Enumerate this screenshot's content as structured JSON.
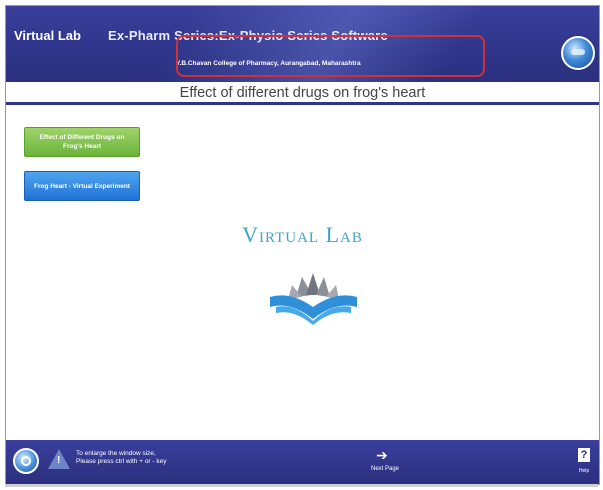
{
  "header": {
    "app_name": "Virtual Lab",
    "software_title": "Ex-Pharm Series:Ex-Physio Series Software",
    "institute": "Y.B.Chavan College of Pharmacy, Aurangabad, Maharashtra",
    "logo_icon": "globe-logo-icon"
  },
  "page": {
    "title": "Effect of different drugs on frog's heart"
  },
  "menu": {
    "items": [
      {
        "label": "Effect of Different Drugs on Frog's Heart",
        "color": "#6bb43a"
      },
      {
        "label": "Frog Heart - Virtual Experiment",
        "color": "#1f72d6"
      }
    ]
  },
  "main": {
    "brand_text": "Virtual Lab",
    "brand_color": "#3fa3c7",
    "brand_icon": "open-book-icon"
  },
  "footer": {
    "hint_line1": "To enlarge the window size,",
    "hint_line2": "Please press ctrl with + or - key",
    "next_label": "Next Page",
    "help_label": "Help",
    "help_symbol": "?",
    "warning_symbol": "!",
    "next_arrow": "➔"
  },
  "colors": {
    "header_bg": "#2f3589",
    "highlight": "#d0303a"
  }
}
